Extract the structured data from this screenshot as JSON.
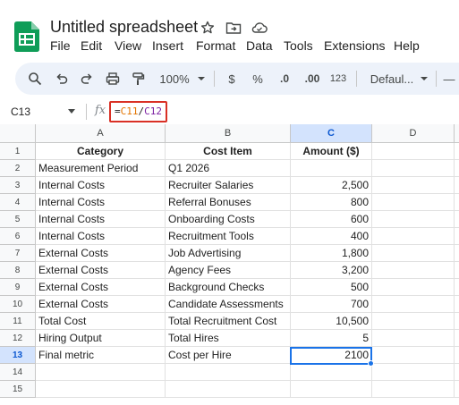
{
  "app": {
    "title": "Untitled spreadsheet",
    "accent": "#0f9d58",
    "selection_color": "#1a73e8"
  },
  "menu": [
    "File",
    "Edit",
    "View",
    "Insert",
    "Format",
    "Data",
    "Tools",
    "Extensions",
    "Help"
  ],
  "toolbar": {
    "zoom": "100%",
    "currency": "$",
    "percent": "%",
    "decrease_decimal": ".0",
    "increase_decimal": ".00",
    "number_format": "123",
    "font": "Defaul...",
    "more": "—"
  },
  "formula_bar": {
    "name_box": "C13",
    "fx": "fx",
    "formula_eq": "=",
    "formula_ref1": "C11",
    "formula_op": "/",
    "formula_ref2": "C12"
  },
  "grid": {
    "columns": [
      "A",
      "B",
      "C",
      "D"
    ],
    "selected_column": "C",
    "selected_row": "13",
    "rows": [
      {
        "n": "1",
        "a": "Category",
        "b": "Cost Item",
        "c": "Amount ($)",
        "header": true
      },
      {
        "n": "2",
        "a": "Measurement Period",
        "b": "Q1 2026",
        "c": ""
      },
      {
        "n": "3",
        "a": "Internal Costs",
        "b": "Recruiter Salaries",
        "c": "2,500"
      },
      {
        "n": "4",
        "a": "Internal Costs",
        "b": "Referral Bonuses",
        "c": "800"
      },
      {
        "n": "5",
        "a": "Internal Costs",
        "b": "Onboarding Costs",
        "c": "600"
      },
      {
        "n": "6",
        "a": "Internal Costs",
        "b": "Recruitment Tools",
        "c": "400"
      },
      {
        "n": "7",
        "a": "External Costs",
        "b": "Job Advertising",
        "c": "1,800"
      },
      {
        "n": "8",
        "a": "External Costs",
        "b": "Agency Fees",
        "c": "3,200"
      },
      {
        "n": "9",
        "a": "External Costs",
        "b": "Background Checks",
        "c": "500"
      },
      {
        "n": "10",
        "a": "External Costs",
        "b": "Candidate Assessments",
        "c": "700"
      },
      {
        "n": "11",
        "a": "Total Cost",
        "b": "Total Recruitment Cost",
        "c": "10,500"
      },
      {
        "n": "12",
        "a": "Hiring Output",
        "b": "Total Hires",
        "c": "5"
      },
      {
        "n": "13",
        "a": "Final metric",
        "b": "Cost per Hire",
        "c": "2100"
      },
      {
        "n": "14",
        "a": "",
        "b": "",
        "c": ""
      },
      {
        "n": "15",
        "a": "",
        "b": "",
        "c": ""
      }
    ]
  }
}
